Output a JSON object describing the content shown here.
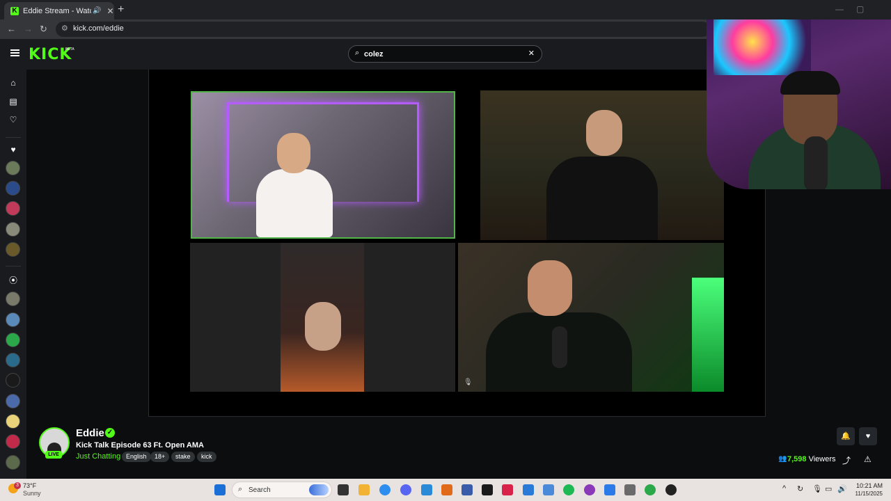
{
  "browser": {
    "tab_title": "Eddie Stream - Watch Live o",
    "new_tab_label": "+",
    "url": "kick.com/eddie"
  },
  "header": {
    "logo_text": "KICK",
    "logo_badge": "BETA",
    "search_value": "colez"
  },
  "stream": {
    "channel_name": "Eddie",
    "live_label": "LIVE",
    "title": "Kick Talk Episode 63 Ft. Open AMA",
    "category": "Just Chatting",
    "tags": [
      "English",
      "18+",
      "stake",
      "kick"
    ],
    "viewer_count": "7,598",
    "viewers_label": "Viewers"
  },
  "taskbar": {
    "weather_badge": "3",
    "temperature": "73°F",
    "condition": "Sunny",
    "search_label": "Search",
    "time": "10:21 AM",
    "date": "11/15/2025"
  },
  "colors": {
    "brand": "#53fc18",
    "background": "#0b0d0e",
    "sidebar": "#191b1f"
  }
}
